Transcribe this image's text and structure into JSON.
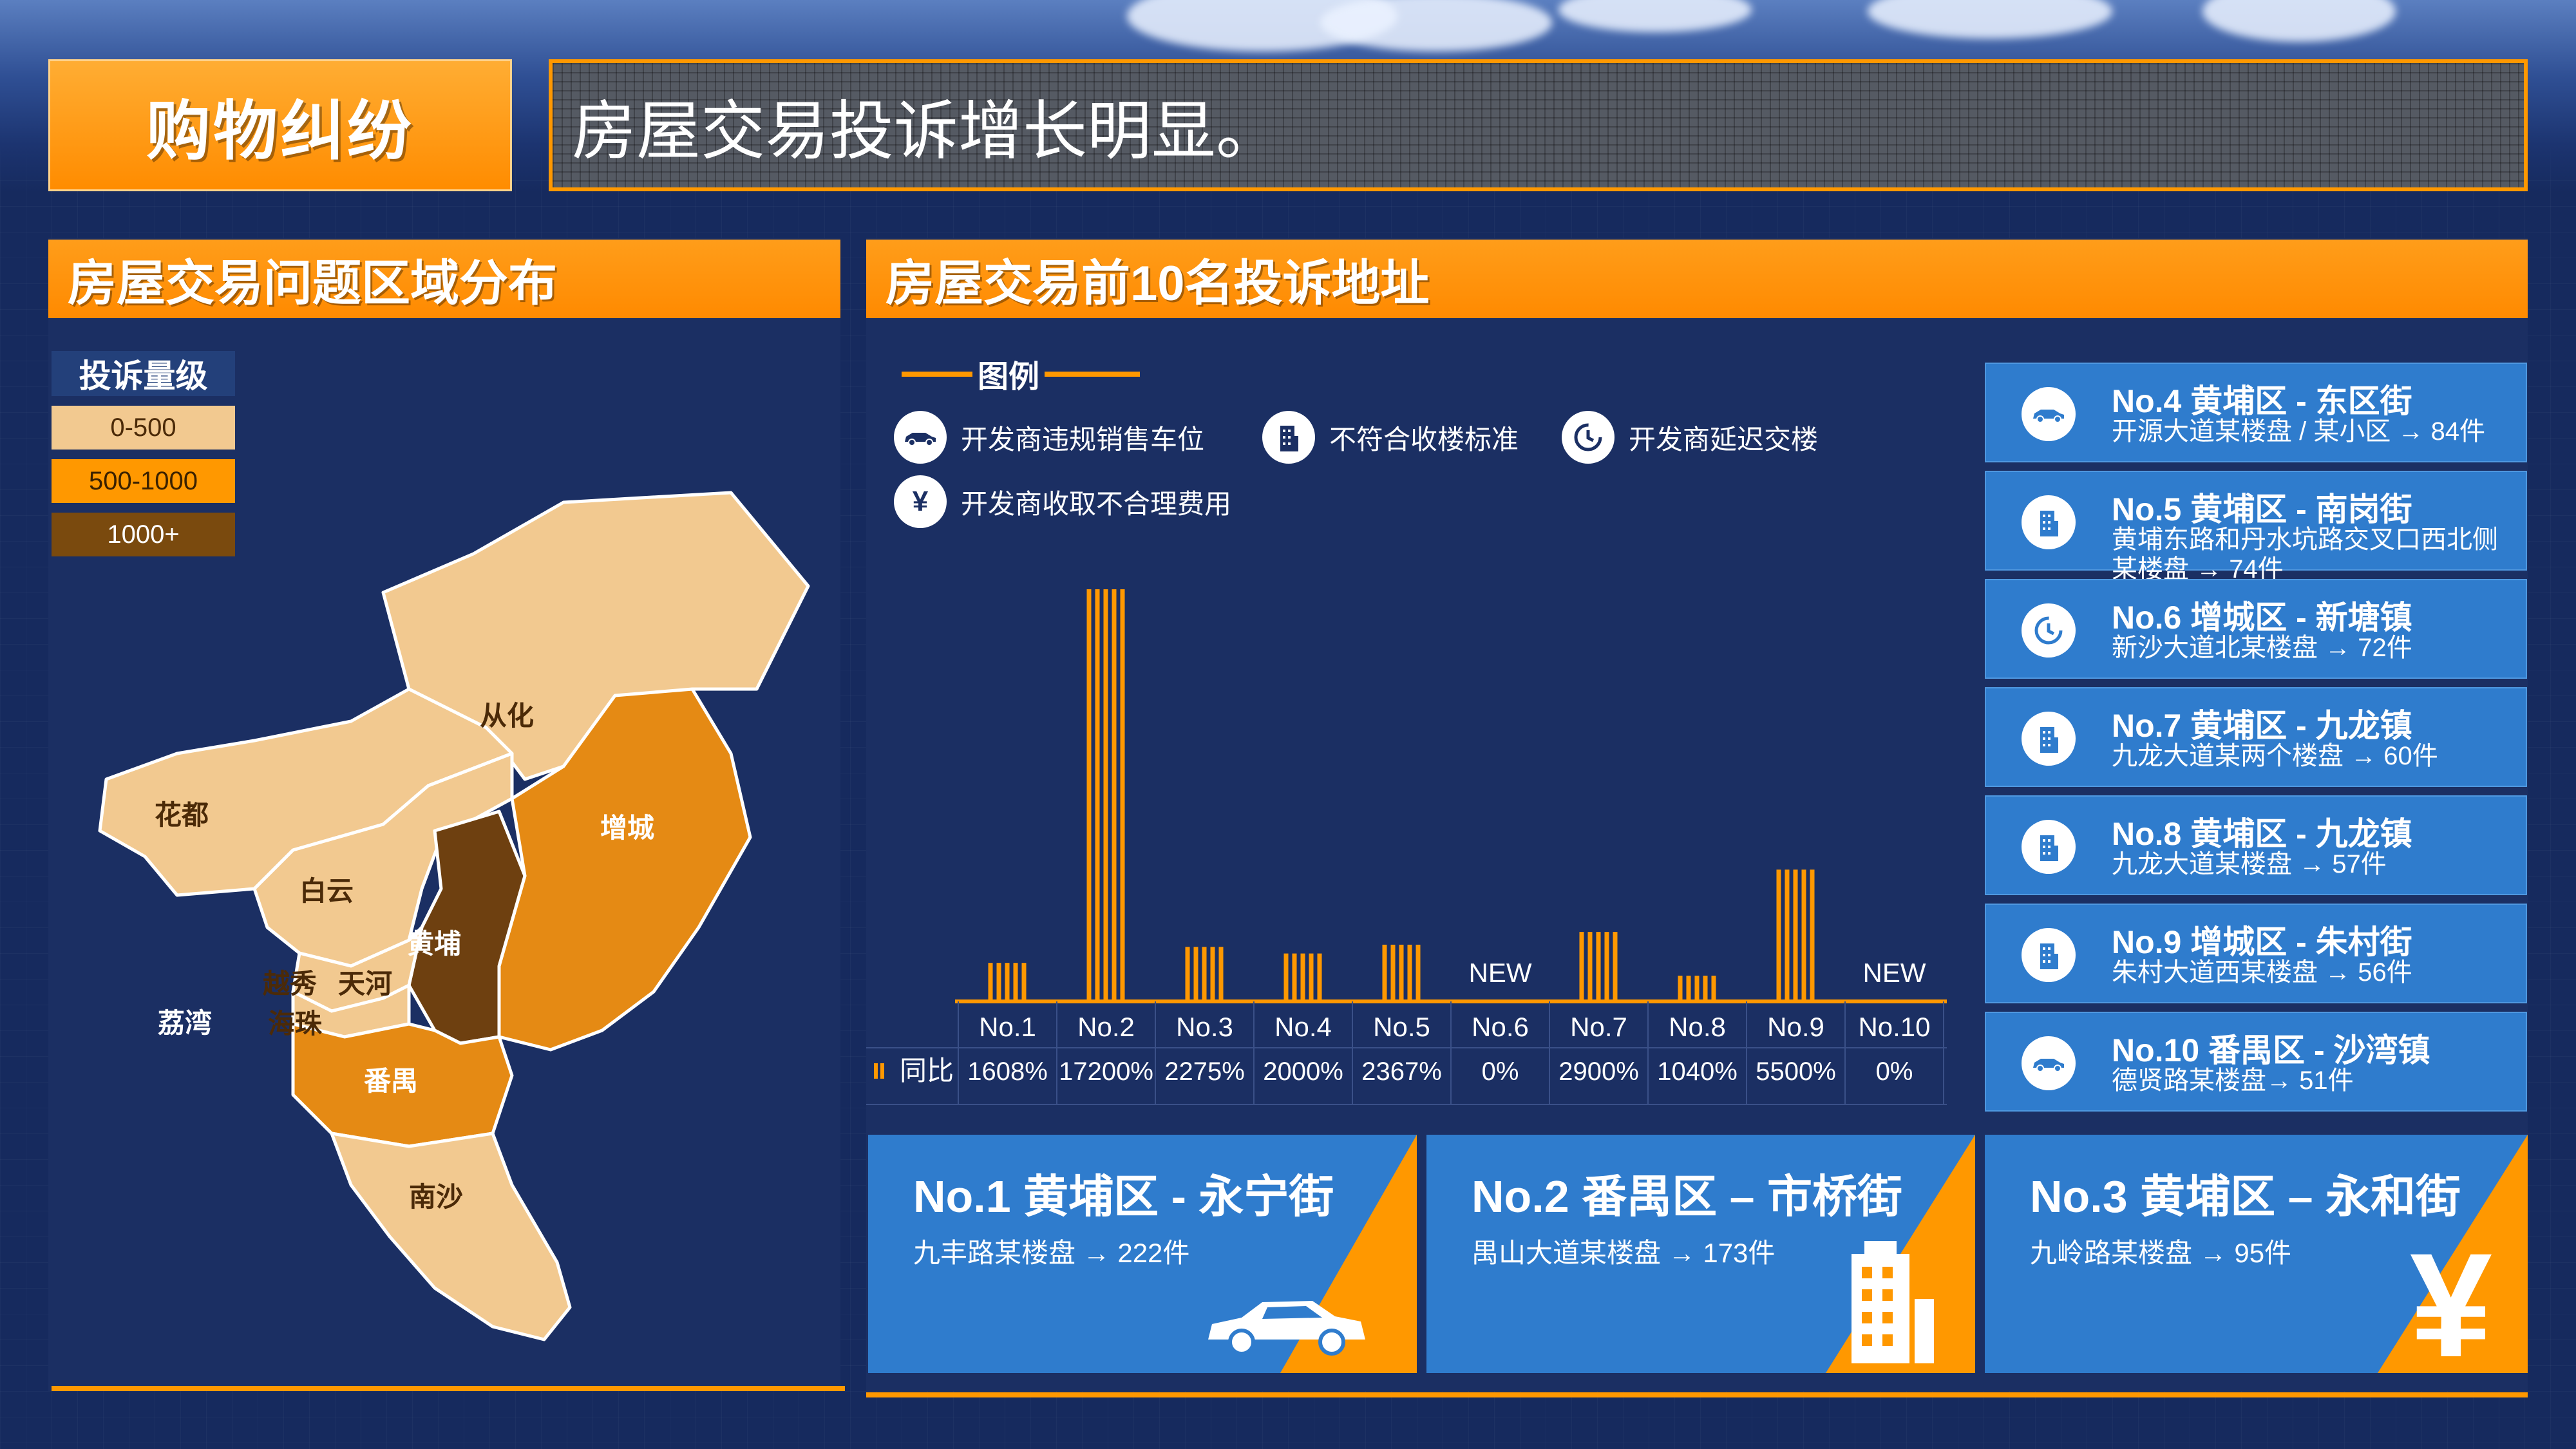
{
  "header": {
    "tag": "购物纠纷",
    "headline": "房屋交易投诉增长明显。"
  },
  "left_panel": {
    "title": "房屋交易问题区域分布",
    "level_legend": {
      "title": "投诉量级",
      "levels": [
        {
          "label": "0-500",
          "color": "#f2c990"
        },
        {
          "label": "500-1000",
          "color": "#ff9800"
        },
        {
          "label": "1000+",
          "color": "#7a4a0e"
        }
      ]
    },
    "districts": [
      "从化",
      "花都",
      "增城",
      "白云",
      "黄埔",
      "越秀",
      "天河",
      "荔湾",
      "海珠",
      "番禺",
      "南沙"
    ]
  },
  "right_panel": {
    "title": "房屋交易前10名投诉地址",
    "legend_title": "图例",
    "legend": [
      {
        "icon": "car-icon",
        "label": "开发商违规销售车位"
      },
      {
        "icon": "building-icon",
        "label": "不符合收楼标准"
      },
      {
        "icon": "clock-icon",
        "label": "开发商延迟交楼"
      },
      {
        "icon": "yen-icon",
        "label": "开发商收取不合理费用",
        "glyph": "¥"
      }
    ],
    "row_label": "同比"
  },
  "chart_data": {
    "type": "bar",
    "categories": [
      "No.1",
      "No.2",
      "No.3",
      "No.4",
      "No.5",
      "No.6",
      "No.7",
      "No.8",
      "No.9",
      "No.10"
    ],
    "values": [
      1608,
      17200,
      2275,
      2000,
      2367,
      null,
      2900,
      1040,
      5500,
      null
    ],
    "value_labels": [
      "1608%",
      "17200%",
      "2275%",
      "2000%",
      "2367%",
      "0%",
      "2900%",
      "1040%",
      "5500%",
      "0%"
    ],
    "bar_annotations": [
      "",
      "",
      "",
      "",
      "",
      "NEW",
      "",
      "",
      "",
      "NEW"
    ],
    "ylim": [
      0,
      17200
    ],
    "bar_color": "#ff9800",
    "grid": false
  },
  "ranks": [
    {
      "icon": "car-icon",
      "title": "No.4 黄埔区 - 东区街",
      "detail": "开源大道某楼盘 / 某小区 → 84件"
    },
    {
      "icon": "building-icon",
      "title": "No.5 黄埔区 - 南岗街",
      "detail": "黄埔东路和丹水坑路交叉口西北侧某楼盘 → 74件"
    },
    {
      "icon": "clock-icon",
      "title": "No.6 增城区 - 新塘镇",
      "detail": "新沙大道北某楼盘 → 72件"
    },
    {
      "icon": "building-icon",
      "title": "No.7 黄埔区 - 九龙镇",
      "detail": "九龙大道某两个楼盘 → 60件"
    },
    {
      "icon": "building-icon",
      "title": "No.8 黄埔区 - 九龙镇",
      "detail": "九龙大道某楼盘 → 57件"
    },
    {
      "icon": "building-icon",
      "title": "No.9 增城区 - 朱村街",
      "detail": "朱村大道西某楼盘 → 56件"
    },
    {
      "icon": "car-icon",
      "title": "No.10 番禺区 - 沙湾镇",
      "detail": "德贤路某楼盘→ 51件"
    }
  ],
  "top3": [
    {
      "icon": "car-icon",
      "title": "No.1 黄埔区 - 永宁街",
      "detail": "九丰路某楼盘 → 222件"
    },
    {
      "icon": "building-icon",
      "title": "No.2 番禺区 – 市桥街",
      "detail": "禺山大道某楼盘 → 173件"
    },
    {
      "icon": "yen-icon",
      "title": "No.3 黄埔区 – 永和街",
      "detail": "九岭路某楼盘 → 95件",
      "glyph": "¥"
    }
  ],
  "colors": {
    "accent": "#ff9800",
    "card_blue": "#2f7ccd",
    "panel": "#1b2f63",
    "background": "#162a5e"
  }
}
